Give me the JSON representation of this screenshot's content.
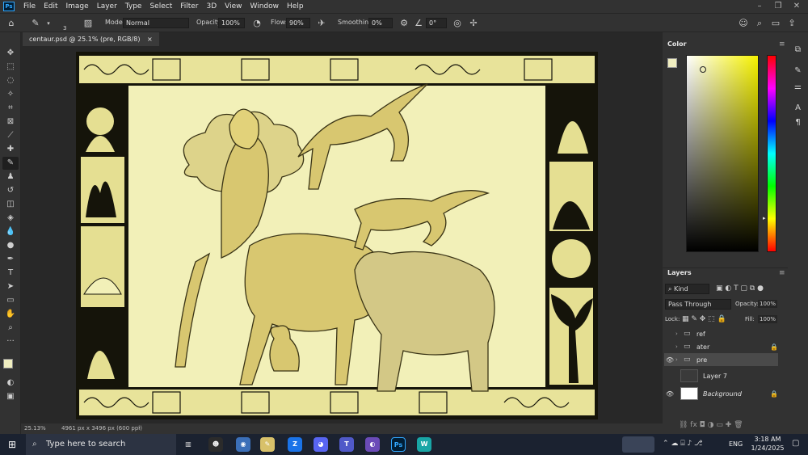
{
  "menubar": {
    "app_icon": "Ps",
    "items": [
      "File",
      "Edit",
      "Image",
      "Layer",
      "Type",
      "Select",
      "Filter",
      "3D",
      "View",
      "Window",
      "Help"
    ],
    "window_controls": [
      "minimize-icon",
      "maximize-icon",
      "close-icon"
    ]
  },
  "options": {
    "brush_size": "3",
    "mode_label": "Mode:",
    "mode_value": "Normal",
    "opacity_label": "Opacity:",
    "opacity_value": "100%",
    "flow_label": "Flow:",
    "flow_value": "90%",
    "smoothing_label": "Smoothing:",
    "smoothing_value": "0%",
    "angle_value": "0°"
  },
  "document": {
    "tab_title": "centaur.psd @ 25.1% (pre, RGB/8)",
    "close": "×"
  },
  "status": {
    "zoom": "25.13%",
    "dimensions": "4961 px x 3496 px (600 ppi)"
  },
  "color_panel": {
    "title": "Color",
    "foreground": "#f0eec0",
    "background": "#4a4420"
  },
  "layers_panel": {
    "title": "Layers",
    "filter_label": "Kind",
    "blend_mode": "Pass Through",
    "opacity_label": "Opacity:",
    "opacity_value": "100%",
    "lock_label": "Lock:",
    "fill_label": "Fill:",
    "fill_value": "100%",
    "layers": [
      {
        "name": "ref",
        "type": "group",
        "visible": false,
        "locked": false
      },
      {
        "name": "ater",
        "type": "group",
        "visible": false,
        "locked": true
      },
      {
        "name": "pre",
        "type": "group",
        "visible": true,
        "locked": false,
        "selected": true
      },
      {
        "name": "Layer 7",
        "type": "layer",
        "visible": false,
        "locked": false
      },
      {
        "name": "Background",
        "type": "layer",
        "visible": true,
        "locked": true
      }
    ]
  },
  "taskbar": {
    "search_placeholder": "Type here to search",
    "language": "ENG",
    "time": "3:18 AM",
    "date": "1/24/2025",
    "apps": [
      "task-view",
      "game-app",
      "browser",
      "notes",
      "zalo",
      "discord",
      "teams",
      "vpn",
      "photoshop",
      "wordweb"
    ]
  }
}
